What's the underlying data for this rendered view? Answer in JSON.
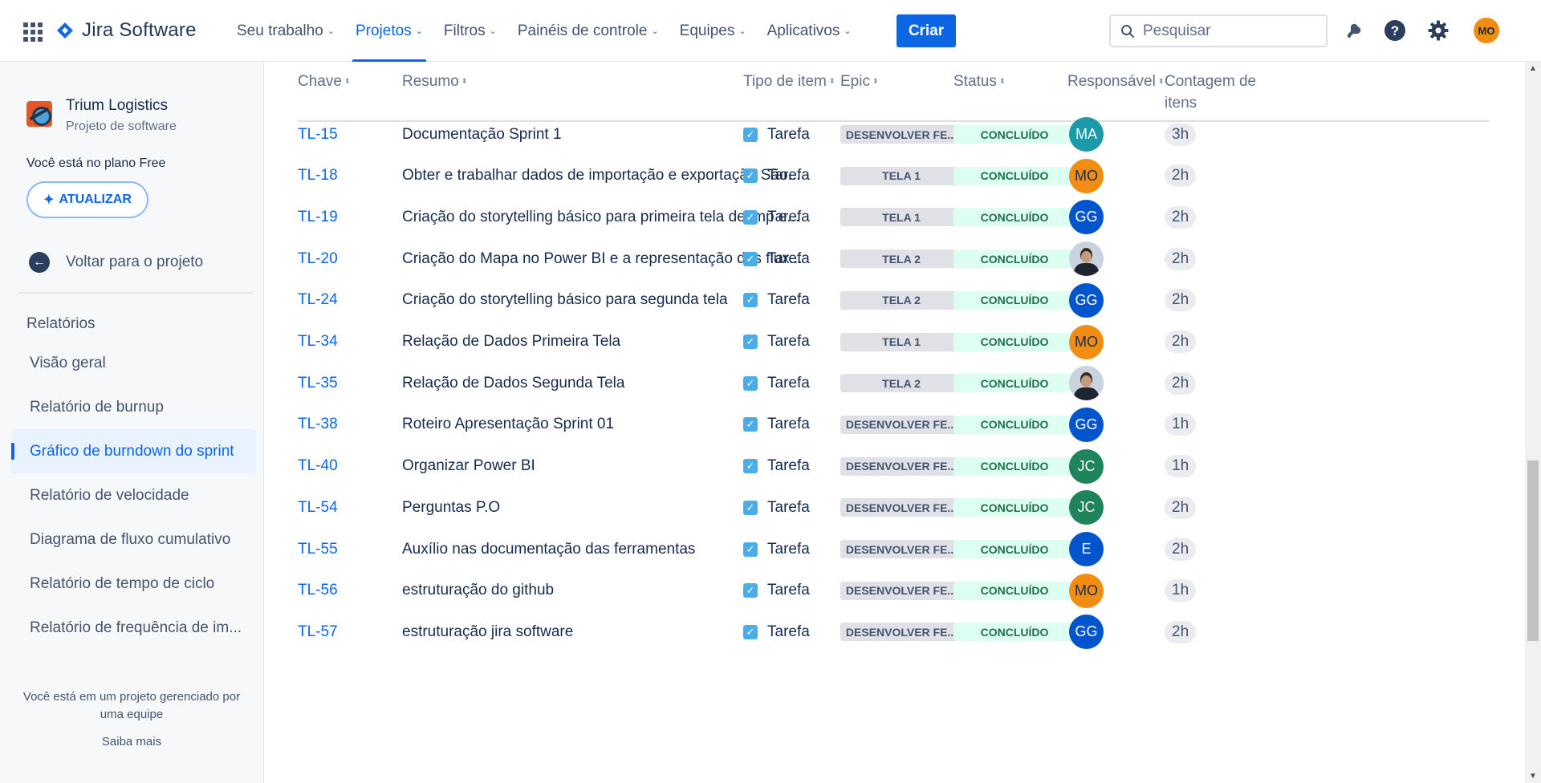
{
  "topnav": {
    "logo_text": "Jira Software",
    "items": [
      {
        "label": "Seu trabalho",
        "active": false
      },
      {
        "label": "Projetos",
        "active": true
      },
      {
        "label": "Filtros",
        "active": false
      },
      {
        "label": "Painéis de controle",
        "active": false
      },
      {
        "label": "Equipes",
        "active": false
      },
      {
        "label": "Aplicativos",
        "active": false
      }
    ],
    "create_label": "Criar",
    "search_placeholder": "Pesquisar",
    "user_initials": "MO",
    "accent_color": "#0c66e4"
  },
  "sidebar": {
    "project_name": "Trium Logistics",
    "project_type": "Projeto de software",
    "plan_text": "Você está no plano Free",
    "upgrade_label": "ATUALIZAR",
    "back_label": "Voltar para o projeto",
    "section_title": "Relatórios",
    "menu": [
      {
        "label": "Visão geral",
        "active": false
      },
      {
        "label": "Relatório de burnup",
        "active": false
      },
      {
        "label": "Gráfico de burndown do sprint",
        "active": true
      },
      {
        "label": "Relatório de velocidade",
        "active": false
      },
      {
        "label": "Diagrama de fluxo cumulativo",
        "active": false
      },
      {
        "label": "Relatório de tempo de ciclo",
        "active": false
      },
      {
        "label": "Relatório de frequência de im...",
        "active": false
      }
    ],
    "footer_note": "Você está em um projeto gerenciado por uma equipe",
    "footer_link": "Saiba mais"
  },
  "table": {
    "headers": {
      "key": "Chave",
      "summary": "Resumo",
      "type": "Tipo de item",
      "epic": "Epic",
      "status": "Status",
      "assignee": "Responsável",
      "count_line1": "Contagem de",
      "count_line2": "itens"
    },
    "rows": [
      {
        "key": "TL-15",
        "summary": "Documentação Sprint 1",
        "type": "Tarefa",
        "epic": "DESENVOLVER FE...",
        "status": "CONCLUÍDO",
        "assignee": "MA",
        "avatar_color": "#1d9aaa",
        "count": "3h"
      },
      {
        "key": "TL-18",
        "summary": "Obter e trabalhar dados de importação e exportação São...",
        "type": "Tarefa",
        "epic": "TELA 1",
        "status": "CONCLUÍDO",
        "assignee": "MO",
        "avatar_color": "#f18d13",
        "count": "2h"
      },
      {
        "key": "TL-19",
        "summary": "Criação do storytelling básico para primeira tela de imp e...",
        "type": "Tarefa",
        "epic": "TELA 1",
        "status": "CONCLUÍDO",
        "assignee": "GG",
        "avatar_color": "#0055cc",
        "count": "2h"
      },
      {
        "key": "TL-20",
        "summary": "Criação do Mapa no Power BI e a representação dos flux...",
        "type": "Tarefa",
        "epic": "TELA 2",
        "status": "CONCLUÍDO",
        "assignee": "",
        "avatar_color": "photo",
        "count": "2h"
      },
      {
        "key": "TL-24",
        "summary": "Criação do storytelling básico para segunda tela",
        "type": "Tarefa",
        "epic": "TELA 2",
        "status": "CONCLUÍDO",
        "assignee": "GG",
        "avatar_color": "#0055cc",
        "count": "2h"
      },
      {
        "key": "TL-34",
        "summary": "Relação de Dados Primeira Tela",
        "type": "Tarefa",
        "epic": "TELA 1",
        "status": "CONCLUÍDO",
        "assignee": "MO",
        "avatar_color": "#f18d13",
        "count": "2h"
      },
      {
        "key": "TL-35",
        "summary": "Relação de Dados Segunda Tela",
        "type": "Tarefa",
        "epic": "TELA 2",
        "status": "CONCLUÍDO",
        "assignee": "",
        "avatar_color": "photo",
        "count": "2h"
      },
      {
        "key": "TL-38",
        "summary": "Roteiro Apresentação Sprint 01",
        "type": "Tarefa",
        "epic": "DESENVOLVER FE...",
        "status": "CONCLUÍDO",
        "assignee": "GG",
        "avatar_color": "#0055cc",
        "count": "1h"
      },
      {
        "key": "TL-40",
        "summary": "Organizar Power BI",
        "type": "Tarefa",
        "epic": "DESENVOLVER FE...",
        "status": "CONCLUÍDO",
        "assignee": "JC",
        "avatar_color": "#1f845a",
        "count": "1h"
      },
      {
        "key": "TL-54",
        "summary": "Perguntas P.O",
        "type": "Tarefa",
        "epic": "DESENVOLVER FE...",
        "status": "CONCLUÍDO",
        "assignee": "JC",
        "avatar_color": "#1f845a",
        "count": "2h"
      },
      {
        "key": "TL-55",
        "summary": "Auxílio nas documentação das ferramentas",
        "type": "Tarefa",
        "epic": "DESENVOLVER FE...",
        "status": "CONCLUÍDO",
        "assignee": "E",
        "avatar_color": "#0055cc",
        "count": "2h"
      },
      {
        "key": "TL-56",
        "summary": "estruturação do github",
        "type": "Tarefa",
        "epic": "DESENVOLVER FE...",
        "status": "CONCLUÍDO",
        "assignee": "MO",
        "avatar_color": "#f18d13",
        "count": "1h"
      },
      {
        "key": "TL-57",
        "summary": "estruturação jira software",
        "type": "Tarefa",
        "epic": "DESENVOLVER FE...",
        "status": "CONCLUÍDO",
        "assignee": "GG",
        "avatar_color": "#0055cc",
        "count": "2h"
      }
    ]
  }
}
